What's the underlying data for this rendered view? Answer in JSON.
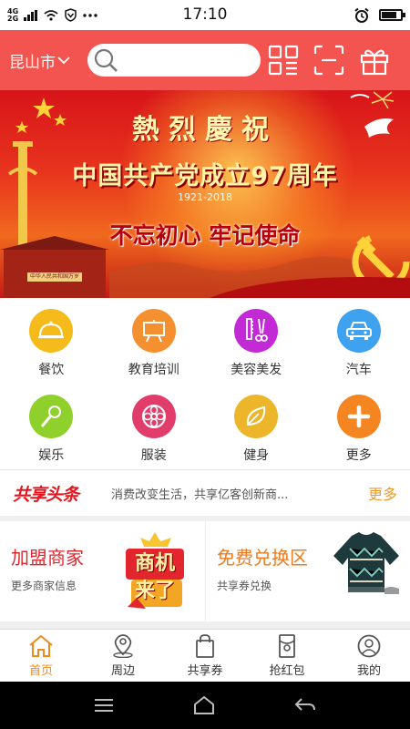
{
  "status_bar": {
    "network_1": "4G",
    "network_2": "2G",
    "time": "17:10",
    "battery_level": 0.8
  },
  "header": {
    "city": "昆山市",
    "search_placeholder": ""
  },
  "banner": {
    "title_1": "熱烈慶祝",
    "title_2": "中国共产党成立97周年",
    "years": "1921-2018",
    "slogan": "不忘初心 牢记使命",
    "gate_sign": "中华人民共和国万岁"
  },
  "categories": [
    {
      "label": "餐饮",
      "icon": "dining-icon",
      "color": "#f5bb1b"
    },
    {
      "label": "教育培训",
      "icon": "easel-icon",
      "color": "#f4902f"
    },
    {
      "label": "美容美发",
      "icon": "comb-scissors-icon",
      "color": "#c22ad6"
    },
    {
      "label": "汽车",
      "icon": "car-icon",
      "color": "#3ea2ef"
    },
    {
      "label": "娱乐",
      "icon": "microphone-icon",
      "color": "#8fd02c"
    },
    {
      "label": "服装",
      "icon": "fabric-icon",
      "color": "#e23c6b"
    },
    {
      "label": "健身",
      "icon": "leaf-icon",
      "color": "#edb62a"
    },
    {
      "label": "更多",
      "icon": "plus-icon",
      "color": "#f58521"
    }
  ],
  "news": {
    "logo": "共享头条",
    "text": "消费改变生活，共享亿客创新商...",
    "more": "更多"
  },
  "promos": [
    {
      "title": "加盟商家",
      "subtitle": "更多商家信息",
      "title_color": "#e3262d",
      "image_text": "商机来了"
    },
    {
      "title": "免费兑换区",
      "subtitle": "共享券兑换",
      "title_color": "#f07a1e"
    }
  ],
  "tabs": [
    {
      "label": "首页",
      "icon": "home-icon",
      "active": true
    },
    {
      "label": "周边",
      "icon": "location-pin-icon",
      "active": false
    },
    {
      "label": "共享券",
      "icon": "shopping-bag-icon",
      "active": false
    },
    {
      "label": "抢红包",
      "icon": "red-envelope-icon",
      "active": false
    },
    {
      "label": "我的",
      "icon": "user-icon",
      "active": false
    }
  ],
  "accent_color": "#f4544f",
  "tab_active_color": "#f08a1c"
}
